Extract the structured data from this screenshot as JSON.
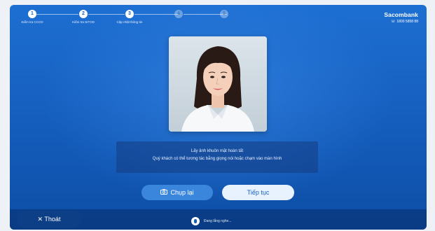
{
  "stepper": {
    "steps": [
      {
        "number": "1",
        "label": "Kiểm tra CCCD",
        "state": "done"
      },
      {
        "number": "2",
        "label": "Kiểm tra SITOD",
        "state": "done"
      },
      {
        "number": "3",
        "label": "Cập nhật thông tin",
        "state": "active"
      },
      {
        "number": "4",
        "label": "",
        "state": "inactive"
      },
      {
        "number": "5",
        "label": "",
        "state": "inactive"
      }
    ]
  },
  "brand": {
    "name": "Sacombank",
    "phone": "1800 5858 88",
    "phone_icon": "phone-icon"
  },
  "photo": {
    "subject": "portrait-photo"
  },
  "message": {
    "title": "Lấy ảnh khuôn mặt hoàn tất",
    "subtitle": "Quý khách có thể tương tác bằng giọng nói hoặc chạm vào màn hình"
  },
  "actions": {
    "retake_label": "Chụp lại",
    "retake_icon": "camera-icon",
    "continue_label": "Tiếp tục"
  },
  "footer": {
    "exit_label": "✕ Thoát",
    "listening_text": "Đang lắng nghe..."
  },
  "colors": {
    "background": "#1660c0",
    "button_primary": "#3b86dd",
    "button_light": "#e8f2ff"
  }
}
